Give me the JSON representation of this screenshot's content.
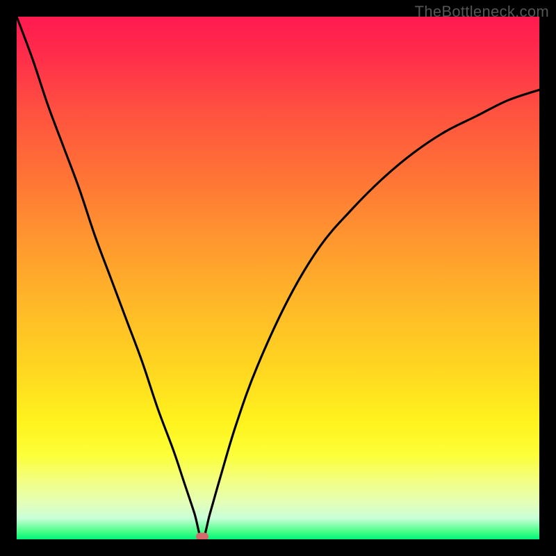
{
  "watermark": "TheBottleneck.com",
  "colors": {
    "background_frame": "#000000",
    "curve": "#000000",
    "vertex_dot": "#d56a6a",
    "gradient_top": "#ff1950",
    "gradient_bottom": "#00f47a"
  },
  "chart_data": {
    "type": "line",
    "title": "",
    "xlabel": "",
    "ylabel": "",
    "xlim": [
      0,
      100
    ],
    "ylim": [
      0,
      100
    ],
    "vertex": {
      "x": 35.5,
      "y": 0
    },
    "annotations": [
      {
        "name": "vertex-marker",
        "x": 35.5,
        "y": 0
      }
    ],
    "series": [
      {
        "name": "bottleneck-curve",
        "x": [
          0,
          3,
          6,
          9,
          12,
          15,
          18,
          21,
          24,
          27,
          30,
          32,
          34,
          35.5,
          37,
          39,
          42,
          46,
          52,
          58,
          64,
          70,
          76,
          82,
          88,
          94,
          100
        ],
        "values": [
          100,
          92,
          83,
          75,
          67,
          58,
          50,
          42,
          34,
          25,
          17,
          11,
          5,
          0,
          5,
          12,
          22,
          33,
          46,
          56,
          63,
          69,
          74,
          78,
          81,
          84,
          86
        ]
      }
    ]
  }
}
